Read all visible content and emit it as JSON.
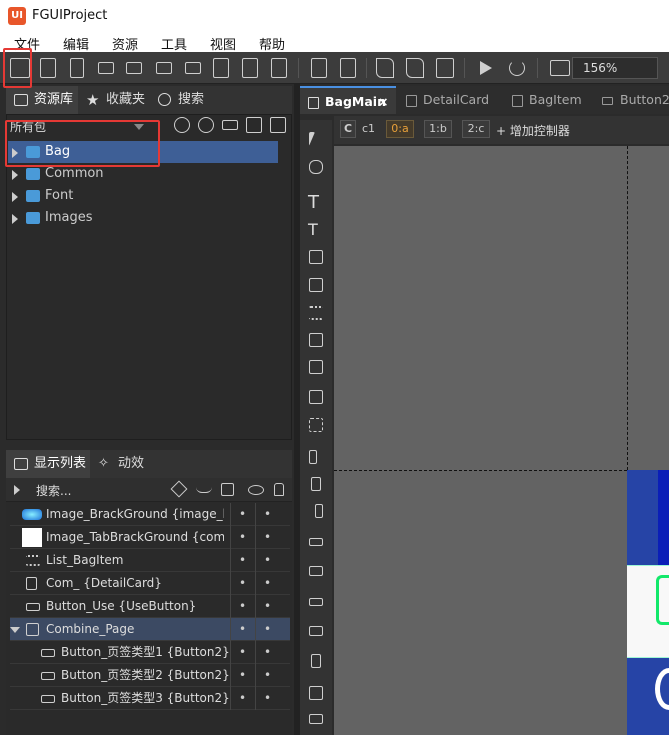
{
  "app": {
    "logo": "UI",
    "title": "FGUIProject"
  },
  "menus": [
    "文件",
    "编辑",
    "资源",
    "工具",
    "视图",
    "帮助"
  ],
  "toolbar": {
    "icons": [
      "new-package-icon",
      "new-file-icon",
      "bookmark-icon",
      "button-icon",
      "combo-icon",
      "progress-icon",
      "slider-icon",
      "font-icon",
      "movieclip-icon",
      "import-icon",
      "save-icon",
      "save-all-icon",
      "publish-icon",
      "publish-all-icon",
      "publish-settings-icon",
      "play-icon",
      "refresh-icon",
      "monitor-icon"
    ],
    "zoom": "156%"
  },
  "library": {
    "tabs": [
      "资源库",
      "收藏夹",
      "搜索"
    ],
    "package_select": "所有包",
    "tree": [
      {
        "label": "Bag",
        "selected": true
      },
      {
        "label": "Common",
        "selected": false
      },
      {
        "label": "Font",
        "selected": false
      },
      {
        "label": "Images",
        "selected": false
      }
    ]
  },
  "display_list": {
    "tabs": [
      "显示列表",
      "动效"
    ],
    "search_placeholder": "搜索...",
    "rows": [
      {
        "name": "Image_BrackGround {image_bg",
        "icon": "image-bg-icon",
        "indent": 0,
        "selected": false
      },
      {
        "name": "Image_TabBrackGround {comm",
        "icon": "image-white-icon",
        "indent": 0,
        "selected": false
      },
      {
        "name": "List_BagItem",
        "icon": "list-icon",
        "indent": 0,
        "selected": false
      },
      {
        "name": "Com_ {DetailCard}",
        "icon": "component-icon",
        "indent": 0,
        "selected": false
      },
      {
        "name": "Button_Use {UseButton}",
        "icon": "button-icon",
        "indent": 0,
        "selected": false
      },
      {
        "name": "Combine_Page",
        "icon": "group-icon",
        "indent": 0,
        "selected": true
      },
      {
        "name": "Button_页签类型1 {Button2}",
        "icon": "button-icon",
        "indent": 1,
        "selected": false
      },
      {
        "name": "Button_页签类型2 {Button2}",
        "icon": "button-icon",
        "indent": 1,
        "selected": false
      },
      {
        "name": "Button_页签类型3 {Button2}",
        "icon": "button-icon",
        "indent": 1,
        "selected": false
      }
    ],
    "dot": "•"
  },
  "documents": {
    "tabs": [
      {
        "label": "BagMain",
        "active": true,
        "close": "×"
      },
      {
        "label": "DetailCard",
        "active": false
      },
      {
        "label": "BagItem",
        "active": false
      },
      {
        "label": "Button2",
        "active": false
      }
    ]
  },
  "controller_bar": {
    "c_label": "C",
    "controller": "c1",
    "pages": [
      "0:a",
      "1:b",
      "2:c"
    ],
    "add_label": "+ 增加控制器"
  },
  "colors": {
    "accent": "#3e5f96",
    "highlight": "#e53935",
    "page_active": "#e8a03a"
  }
}
